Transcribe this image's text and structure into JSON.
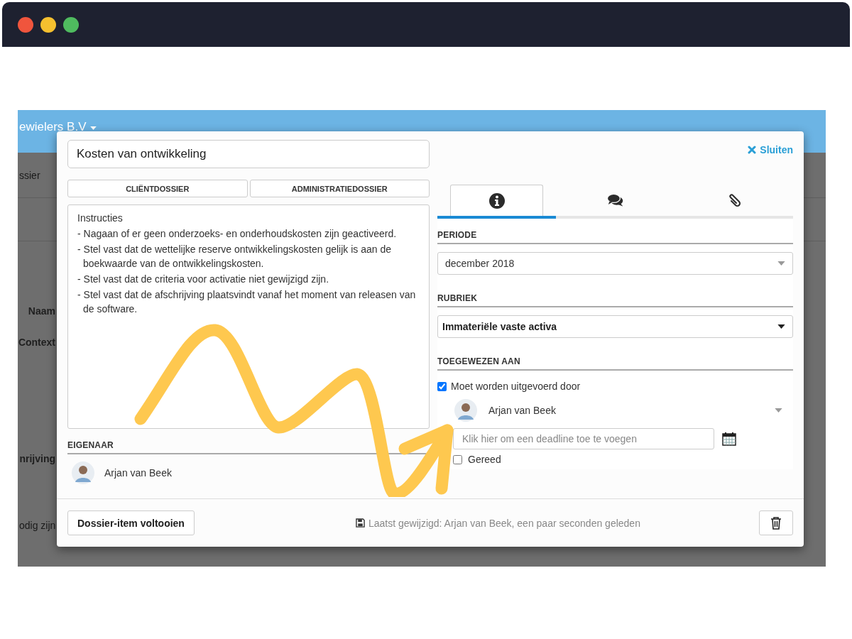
{
  "background_app": {
    "company": "ewielers B.V",
    "tab_fragments": [
      "ssier"
    ],
    "labels": [
      "Naam",
      "Context",
      "nrijving"
    ],
    "footer_text": "odig zijn"
  },
  "modal": {
    "title_value": "Kosten van ontwikkeling",
    "close_label": "Sluiten",
    "doc_tabs": [
      {
        "label": "CLIËNTDOSSIER"
      },
      {
        "label": "ADMINISTRATIEDOSSIER"
      }
    ],
    "instructions": [
      "Instructies",
      "- Nagaan of er geen onderzoeks- en onderhoudskosten zijn geactiveerd.",
      "- Stel vast dat de wettelijke reserve ontwikkelingskosten gelijk is aan de boekwaarde van de ontwikkelingskosten.",
      "- Stel vast dat de criteria voor activatie niet gewijzigd zijn.",
      "- Stel vast dat de afschrijving plaatsvindt vanaf het moment van releasen van de software."
    ],
    "owner": {
      "heading": "EIGENAAR",
      "name": "Arjan van Beek"
    },
    "side_tabs": [
      {
        "kind": "info",
        "selected": true
      },
      {
        "kind": "comments",
        "selected": false
      },
      {
        "kind": "attachments",
        "selected": false
      }
    ],
    "fields": [
      {
        "heading": "PERIODE",
        "value": "december 2018",
        "bold": false
      },
      {
        "heading": "RUBRIEK",
        "value": "Immateriële vaste activa",
        "bold": true
      }
    ],
    "assigned": {
      "heading": "TOEGEWEZEN AAN",
      "must_perform": {
        "label": "Moet worden uitgevoerd door",
        "checked": true
      },
      "assignee": "Arjan van Beek",
      "deadline_placeholder": "Klik hier om een deadline toe te voegen",
      "done": {
        "label": "Gereed",
        "checked": false
      }
    },
    "complete_button": "Dossier-item voltooien",
    "last_modified": "Laatst gewijzigd: Arjan van Beek, een paar seconden geleden"
  }
}
